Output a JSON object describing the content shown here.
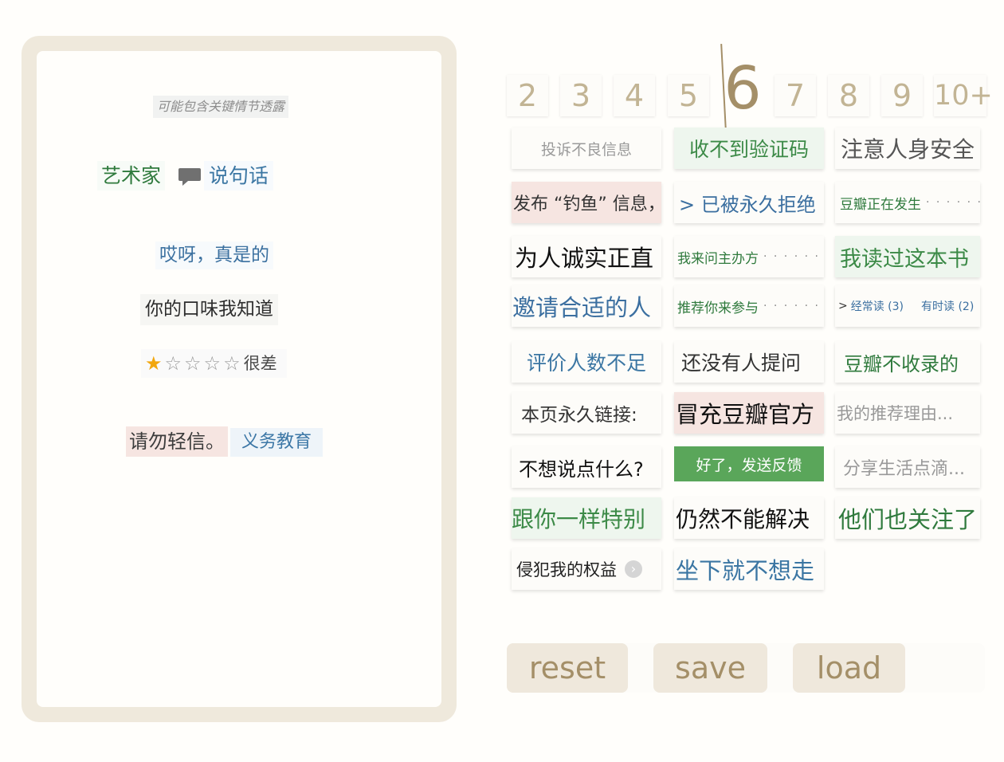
{
  "preview": {
    "spoiler_warning": "可能包含关键情节透露",
    "artist": "艺术家",
    "say_icon": "speech-bubble-icon",
    "say_text": "说句话",
    "exclaim": "哎呀，真是的",
    "taste": "你的口味我知道",
    "rating_stars": "★☆☆☆☆",
    "rating_value": 1,
    "rating_max": 5,
    "rating_text": "很差",
    "caution": "请勿轻信。",
    "education": "义务教育"
  },
  "tabs": {
    "items": [
      "2",
      "3",
      "4",
      "5",
      "6",
      "7",
      "8",
      "9",
      "10+"
    ],
    "active": "6"
  },
  "tiles": {
    "r1": [
      "投诉不良信息",
      "收不到验证码",
      "注意人身安全"
    ],
    "r2a": "发布 “钓鱼” 信息，",
    "r2b": "> 已被永久拒绝",
    "r2c": "豆瓣正在发生",
    "r2c_dots": "· · · · · ·",
    "r3a": "为人诚实正直",
    "r3b": "我来问主办方",
    "r3b_dots": "· · · · · ·",
    "r3c": "我读过这本书",
    "r4a": "邀请合适的人",
    "r4b": "推荐你来参与",
    "r4b_dots": "· · · · · ·",
    "r4c_arrow": ">",
    "r4c1": "经常读 (3)",
    "r4c2": "有时读 (2)",
    "r5": [
      "评价人数不足",
      "还没有人提问",
      "豆瓣不收录的"
    ],
    "r6": [
      "本页永久链接:",
      "冒充豆瓣官方",
      "我的推荐理由..."
    ],
    "r7": [
      "不想说点什么?",
      "好了，发送反馈",
      "分享生活点滴..."
    ],
    "r8": [
      "跟你一样特别",
      "仍然不能解决",
      "他们也关注了"
    ],
    "r9a": "侵犯我的权益",
    "r9a_icon": "chevron-right-icon",
    "r9b": "坐下就不想走"
  },
  "controls": {
    "reset": "reset",
    "save": "save",
    "load": "load"
  },
  "colors": {
    "green": "#2f7a3d",
    "blue": "#3b76a3",
    "accent": "#a48f68",
    "frame": "#efe9dc",
    "green_button": "#5aa65a"
  }
}
